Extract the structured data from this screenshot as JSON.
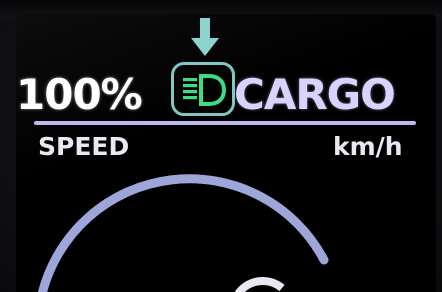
{
  "display": {
    "battery_level": "100%",
    "assist_mode": "CARGO",
    "speed_label": "SPEED",
    "speed_unit": "km/h"
  },
  "indicators": {
    "light_icon": "headlight-icon",
    "light_state": "on",
    "light_color": "#3ddc84",
    "highlight_color": "#7fc8c4",
    "pointer_icon": "down-arrow-icon"
  },
  "colors": {
    "text": "#ffffff",
    "mode_text": "#d8d4ff",
    "divider": "#bdb8f0",
    "gauge_arc": "#9ea6d9"
  }
}
